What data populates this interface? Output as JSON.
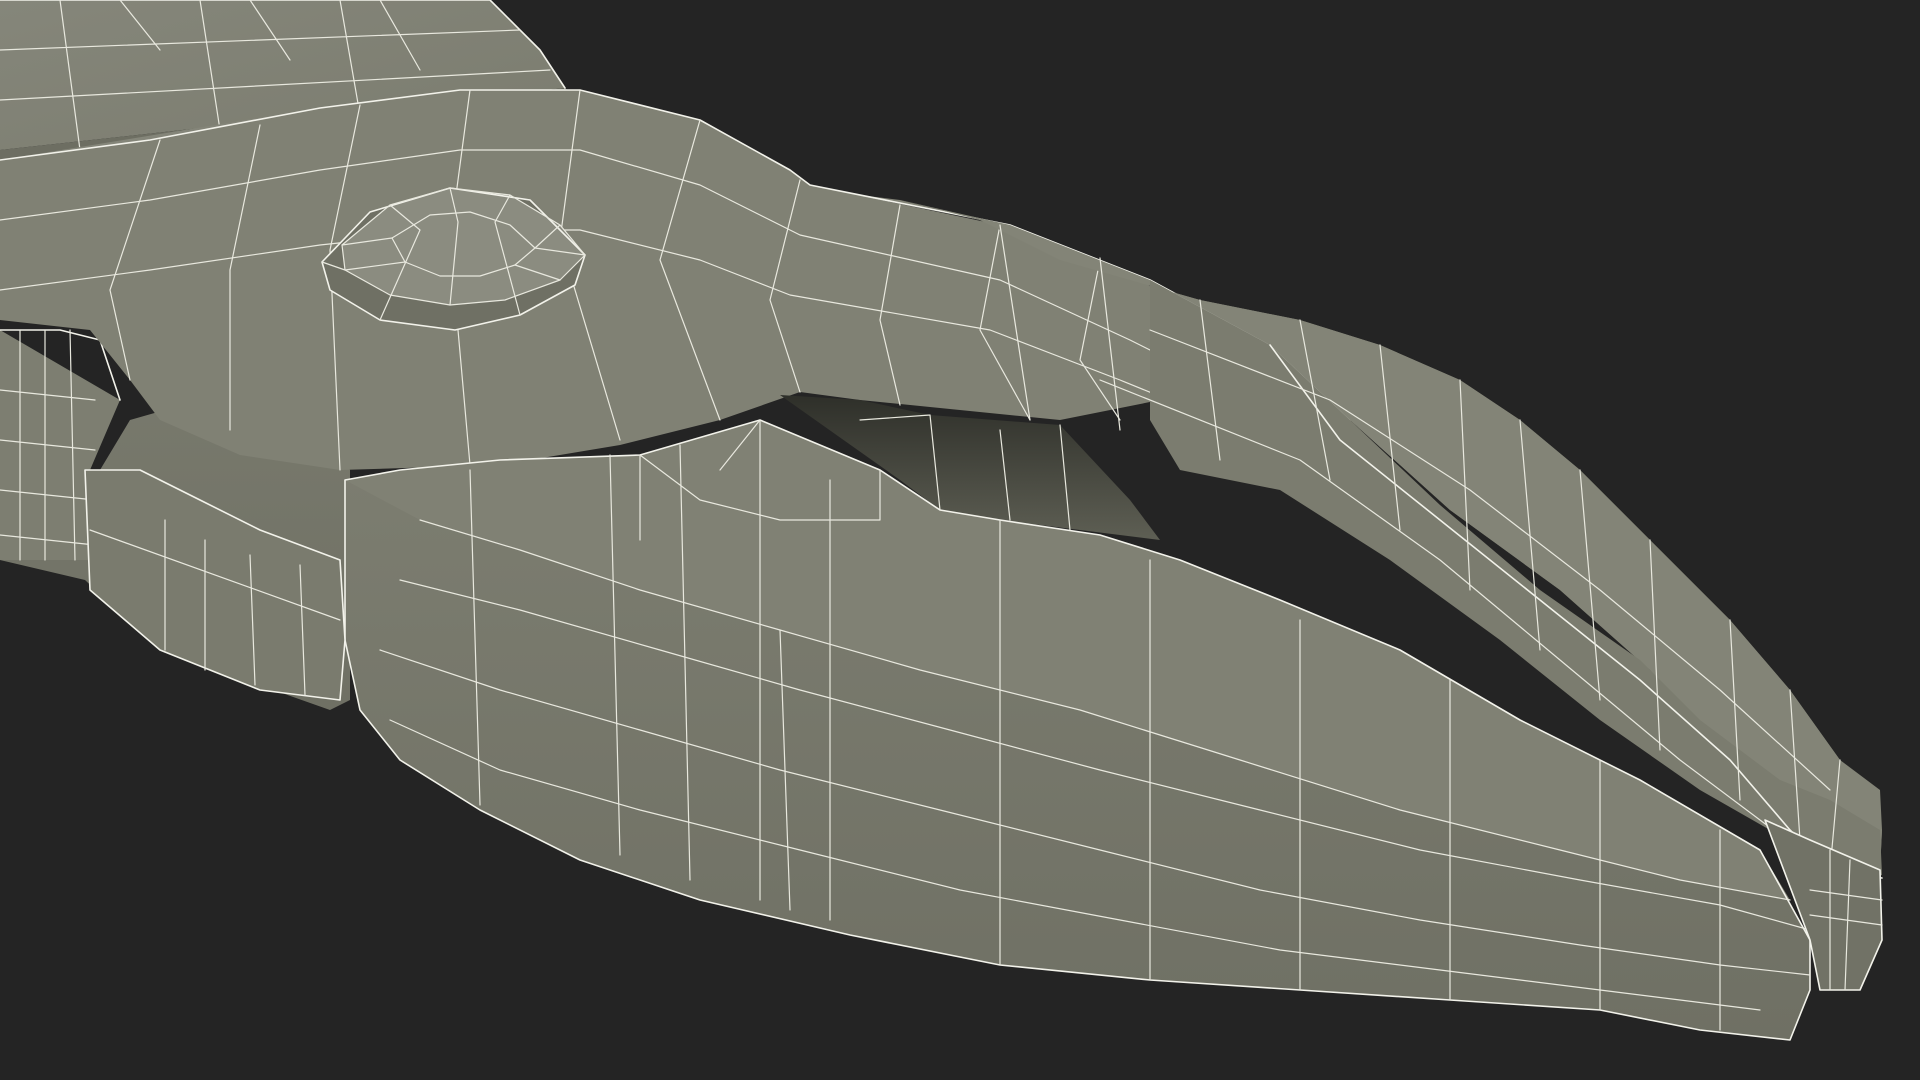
{
  "scene": {
    "subject": "pliers-head-wireframe",
    "colors": {
      "background": "#242424",
      "surface": "#7b7c6f",
      "surface_light": "#85867a",
      "surface_dark": "#6a6b5f",
      "shadow": "#4a4b42",
      "gap": "#3a3b34",
      "wire": "#f2f2ea"
    }
  }
}
